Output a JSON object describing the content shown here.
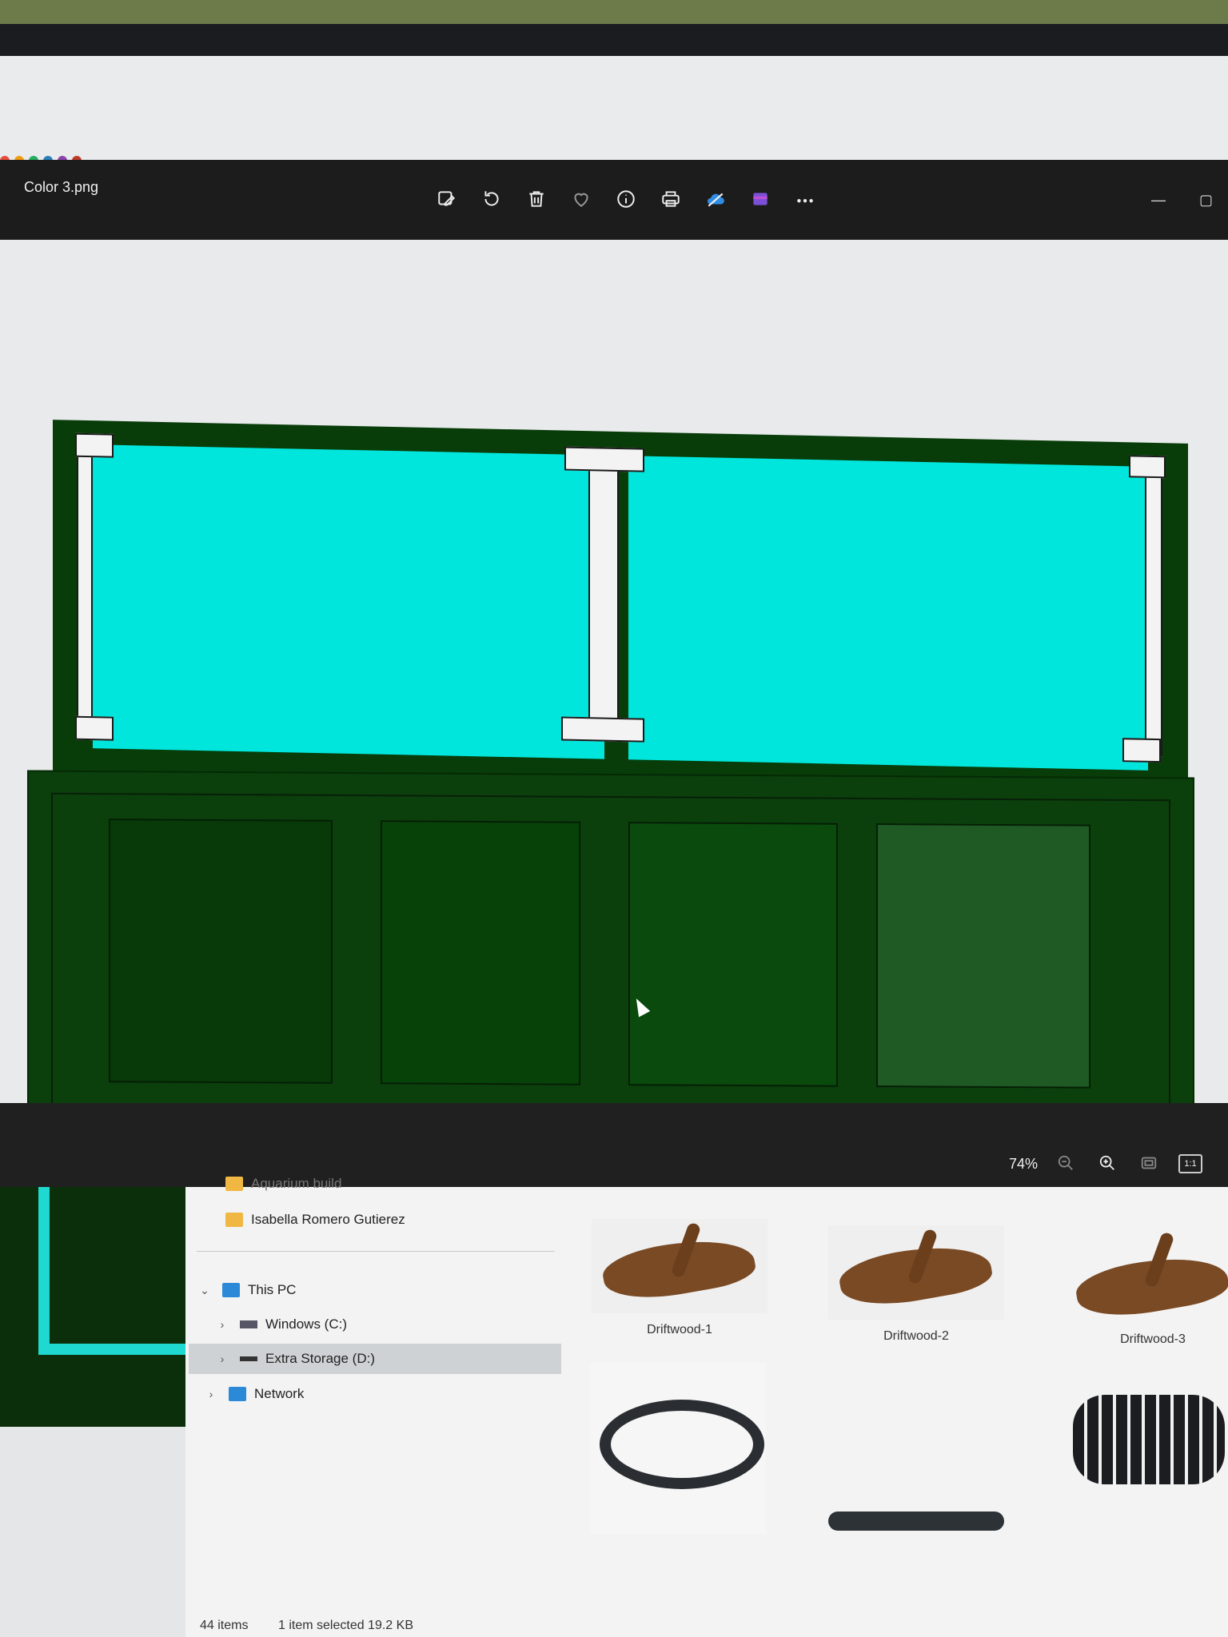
{
  "viewer": {
    "file_title": "Color 3.png",
    "toolbar": [
      {
        "name": "edit-image-icon"
      },
      {
        "name": "rotate-icon"
      },
      {
        "name": "delete-icon"
      },
      {
        "name": "favorite-heart-icon"
      },
      {
        "name": "info-icon"
      },
      {
        "name": "print-icon"
      },
      {
        "name": "onedrive-icon"
      },
      {
        "name": "clipchamp-icon"
      },
      {
        "name": "more-options-icon"
      }
    ],
    "window_controls": {
      "minimize": "—",
      "maximize": "▢"
    },
    "zoom_level": "74%",
    "zoom_tools": [
      "zoom-out-icon",
      "zoom-in-icon",
      "fit-to-window-icon",
      "actual-size-icon"
    ],
    "actual_size_label": "1:1",
    "colors": {
      "glass": "#00e6dc",
      "stand": "#083d09",
      "braces": "#f3f3f3"
    }
  },
  "explorer": {
    "nav": {
      "partial_folder": "Aquarium build",
      "folder_user": "Isabella Romero Gutierez",
      "this_pc": "This PC",
      "drive_c": "Windows (C:)",
      "drive_d": "Extra Storage (D:)",
      "network": "Network"
    },
    "files": [
      {
        "label": "Driftwood-1"
      },
      {
        "label": "Driftwood-2"
      },
      {
        "label": "Driftwood-3"
      }
    ],
    "status": {
      "item_count": "44 items",
      "selection": "1 item selected  19.2 KB"
    }
  }
}
